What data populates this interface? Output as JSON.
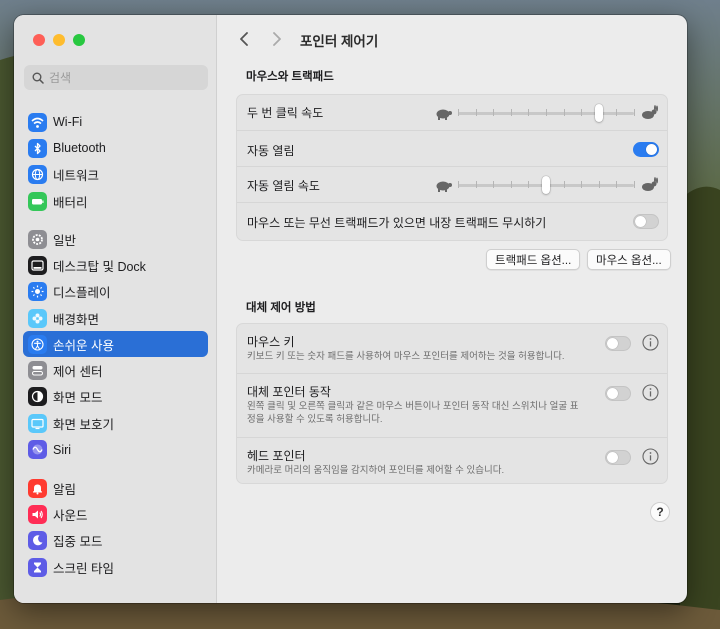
{
  "search": {
    "placeholder": "검색"
  },
  "sidebar": {
    "group1": [
      {
        "label": "Wi-Fi",
        "icon": "wifi-icon",
        "color": "#2a7cf0"
      },
      {
        "label": "Bluetooth",
        "icon": "bluetooth-icon",
        "color": "#2a7cf0"
      },
      {
        "label": "네트워크",
        "icon": "globe-icon",
        "color": "#2a7cf0"
      },
      {
        "label": "배터리",
        "icon": "battery-icon",
        "color": "#34c759"
      }
    ],
    "group2": [
      {
        "label": "일반",
        "icon": "gear-icon",
        "color": "#8e8e93"
      },
      {
        "label": "데스크탑 및 Dock",
        "icon": "dock-icon",
        "color": "#1d1d1f"
      },
      {
        "label": "디스플레이",
        "icon": "sun-icon",
        "color": "#2a7cf0"
      },
      {
        "label": "배경화면",
        "icon": "flower-icon",
        "color": "#5ac8fa"
      },
      {
        "label": "손쉬운 사용",
        "icon": "accessibility-icon",
        "color": "#2a7cf0",
        "active": true
      },
      {
        "label": "제어 센터",
        "icon": "control-center-icon",
        "color": "#8e8e93"
      },
      {
        "label": "화면 모드",
        "icon": "appearance-icon",
        "color": "#1d1d1f"
      },
      {
        "label": "화면 보호기",
        "icon": "screensaver-icon",
        "color": "#5ac8fa"
      },
      {
        "label": "Siri",
        "icon": "siri-icon",
        "color": "#5e5ce6"
      }
    ],
    "group3": [
      {
        "label": "알림",
        "icon": "bell-icon",
        "color": "#ff3b30"
      },
      {
        "label": "사운드",
        "icon": "speaker-icon",
        "color": "#ff2d55"
      },
      {
        "label": "집중 모드",
        "icon": "moon-icon",
        "color": "#5e5ce6"
      },
      {
        "label": "스크린 타임",
        "icon": "hourglass-icon",
        "color": "#5e5ce6"
      }
    ]
  },
  "header": {
    "title": "포인터 제어기"
  },
  "mouse_section": {
    "title": "마우스와 트랙패드",
    "double_click_label": "두 번 클릭 속도",
    "double_click_value": 0.8,
    "spring_loading_label": "자동 열림",
    "spring_loading_on": true,
    "spring_speed_label": "자동 열림 속도",
    "spring_speed_value": 0.5,
    "ignore_trackpad_label": "마우스 또는 무선 트랙패드가 있으면 내장 트랙패드 무시하기",
    "ignore_trackpad_on": false,
    "trackpad_options_label": "트랙패드 옵션...",
    "mouse_options_label": "마우스 옵션..."
  },
  "alt_section": {
    "title": "대체 제어 방법",
    "rows": [
      {
        "label": "마우스 키",
        "sub": "키보드 키 또는 숫자 패드를 사용하여 마우스 포인터를 제어하는 것을 허용합니다.",
        "on": false
      },
      {
        "label": "대체 포인터 동작",
        "sub": "왼쪽 클릭 및 오른쪽 클릭과 같은 마우스 버튼이나 포인터 동작 대신 스위치나 얼굴 표정을 사용할 수 있도록 허용합니다.",
        "on": false
      },
      {
        "label": "헤드 포인터",
        "sub": "카메라로 머리의 움직임을 감지하여 포인터를 제어할 수 있습니다.",
        "on": false
      }
    ]
  },
  "help": {
    "label": "?"
  }
}
